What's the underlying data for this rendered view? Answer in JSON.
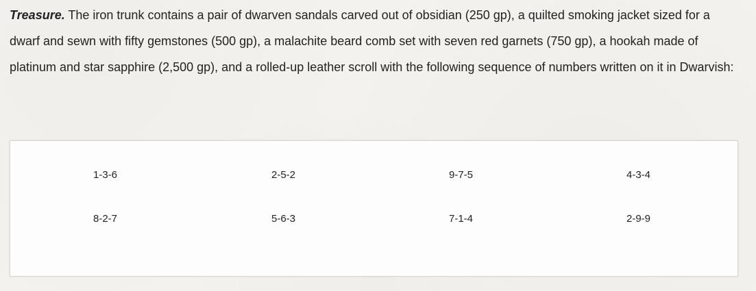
{
  "paragraph": {
    "lead": "Treasure.",
    "text": " The iron trunk contains a pair of dwarven sandals carved out of obsidian (250 gp), a quilted smoking jacket sized for a dwarf and sewn with fifty gemstones (500 gp), a malachite beard comb set with seven red garnets (750 gp), a hookah made of platinum and star sapphire (2,500 gp), and a rolled-up leather scroll with the following sequence of numbers written on it in Dwarvish:"
  },
  "scroll": {
    "rows": [
      [
        "1-3-6",
        "2-5-2",
        "9-7-5",
        "4-3-4"
      ],
      [
        "8-2-7",
        "5-6-3",
        "7-1-4",
        "2-9-9"
      ]
    ]
  }
}
